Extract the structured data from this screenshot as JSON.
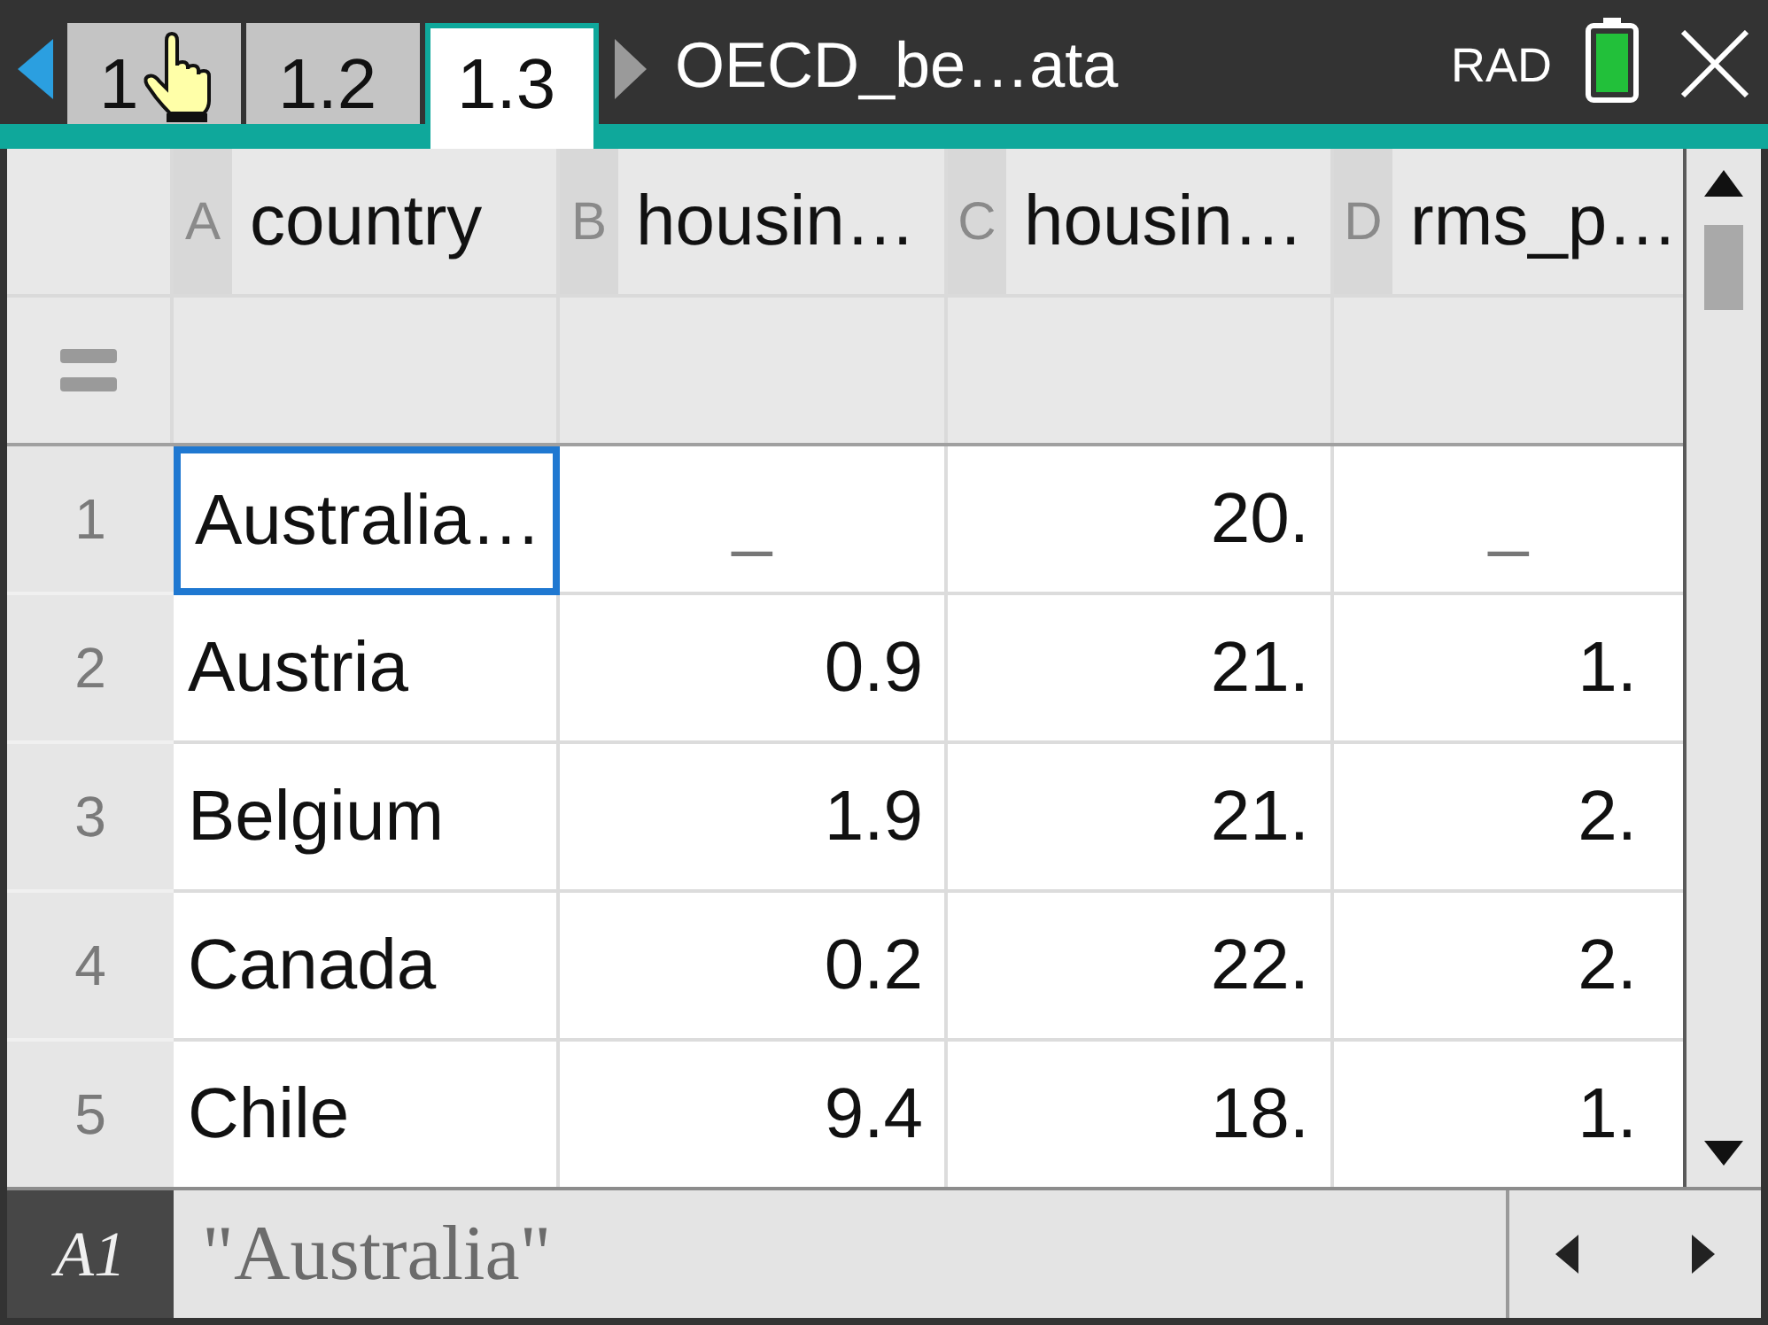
{
  "top_bar": {
    "tabs": [
      {
        "label": "1",
        "selected": false
      },
      {
        "label": "1.2",
        "selected": false
      },
      {
        "label": "1.3",
        "selected": true
      }
    ],
    "document_title": "OECD_be…ata",
    "angle_mode": "RAD"
  },
  "spreadsheet": {
    "columns": [
      {
        "letter": "A",
        "name": "country"
      },
      {
        "letter": "B",
        "name": "housin…"
      },
      {
        "letter": "C",
        "name": "housin…"
      },
      {
        "letter": "D",
        "name": "rms_p…"
      }
    ],
    "rows": [
      {
        "number": "1",
        "cells": [
          {
            "kind": "text",
            "text": "Australia…",
            "selected": true
          },
          {
            "kind": "missing",
            "text": "_",
            "selected": false
          },
          {
            "kind": "number",
            "text": "20.",
            "selected": false
          },
          {
            "kind": "missing",
            "text": "_",
            "selected": false
          }
        ]
      },
      {
        "number": "2",
        "cells": [
          {
            "kind": "text",
            "text": "Austria",
            "selected": false
          },
          {
            "kind": "number",
            "text": "0.9",
            "selected": false
          },
          {
            "kind": "number",
            "text": "21.",
            "selected": false
          },
          {
            "kind": "number",
            "text": "1.",
            "selected": false
          }
        ]
      },
      {
        "number": "3",
        "cells": [
          {
            "kind": "text",
            "text": "Belgium",
            "selected": false
          },
          {
            "kind": "number",
            "text": "1.9",
            "selected": false
          },
          {
            "kind": "number",
            "text": "21.",
            "selected": false
          },
          {
            "kind": "number",
            "text": "2.",
            "selected": false
          }
        ]
      },
      {
        "number": "4",
        "cells": [
          {
            "kind": "text",
            "text": "Canada",
            "selected": false
          },
          {
            "kind": "number",
            "text": "0.2",
            "selected": false
          },
          {
            "kind": "number",
            "text": "22.",
            "selected": false
          },
          {
            "kind": "number",
            "text": "2.",
            "selected": false
          }
        ]
      },
      {
        "number": "5",
        "cells": [
          {
            "kind": "text",
            "text": "Chile",
            "selected": false
          },
          {
            "kind": "number",
            "text": "9.4",
            "selected": false
          },
          {
            "kind": "number",
            "text": "18.",
            "selected": false
          },
          {
            "kind": "number",
            "text": "1.",
            "selected": false
          }
        ]
      }
    ]
  },
  "entry_line": {
    "cell_reference": "A1",
    "value": "\"Australia\""
  }
}
